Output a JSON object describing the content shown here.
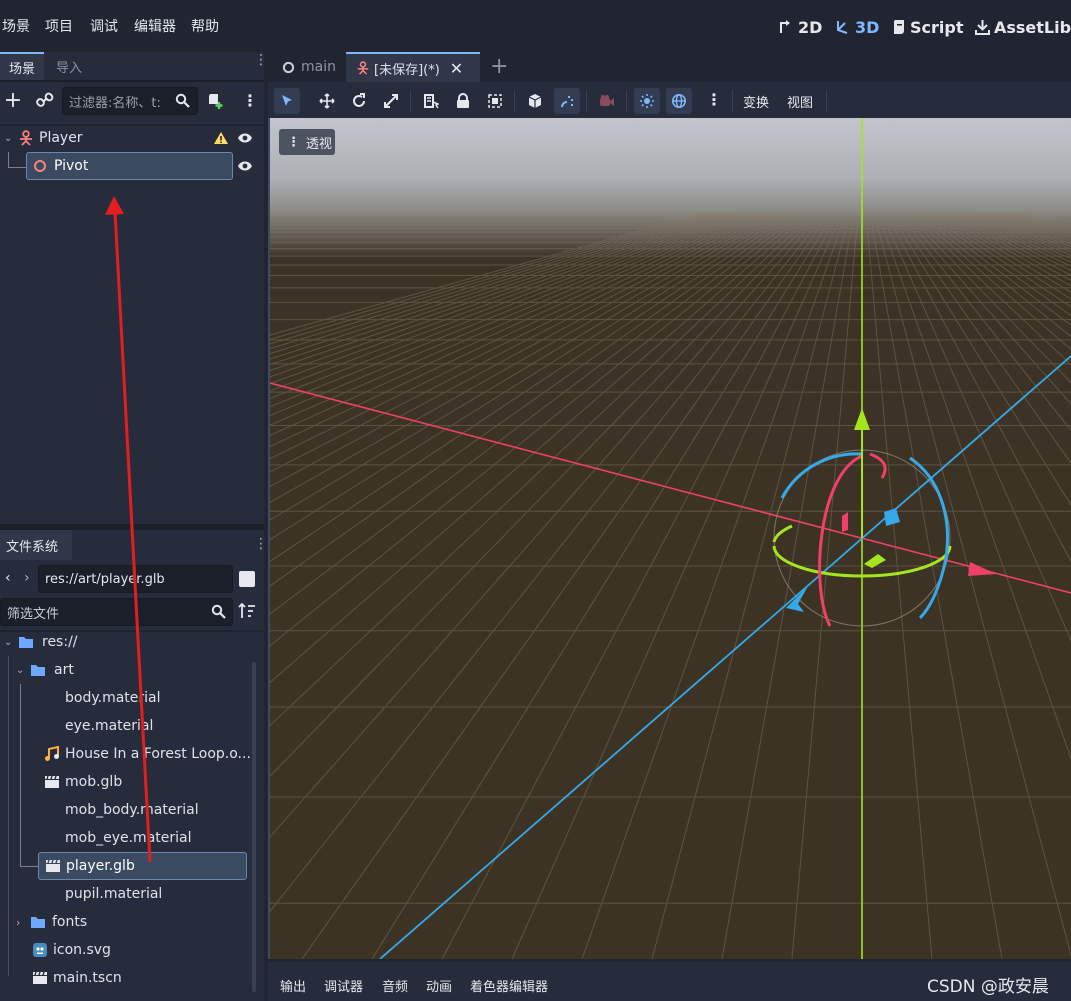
{
  "menu": [
    "场景",
    "项目",
    "调试",
    "编辑器",
    "帮助"
  ],
  "modes": [
    {
      "label": "2D",
      "icon": "2d-mode-icon",
      "active": false
    },
    {
      "label": "3D",
      "icon": "3d-mode-icon",
      "active": true
    },
    {
      "label": "Script",
      "icon": "script-icon",
      "active": false
    },
    {
      "label": "AssetLib",
      "icon": "assetlib-icon",
      "active": false
    }
  ],
  "scene_dock": {
    "tabs": [
      "场景",
      "导入"
    ],
    "filter_placeholder": "过滤器:名称、t:",
    "tree": [
      {
        "label": "Player",
        "icon": "character-node-icon",
        "warning": true
      },
      {
        "label": "Pivot",
        "icon": "node3d-icon",
        "selected": true
      }
    ]
  },
  "filesystem": {
    "tab": "文件系统",
    "path": "res://art/player.glb",
    "filter_placeholder": "筛选文件",
    "items": [
      {
        "label": "res://",
        "icon": "folder-icon",
        "level": 0
      },
      {
        "label": "art",
        "icon": "folder-icon",
        "level": 1
      },
      {
        "label": "body.material",
        "icon": "",
        "level": 2
      },
      {
        "label": "eye.material",
        "icon": "",
        "level": 2
      },
      {
        "label": "House In a Forest Loop.o...",
        "icon": "audio-icon",
        "level": 2
      },
      {
        "label": "mob.glb",
        "icon": "scene-icon",
        "level": 2
      },
      {
        "label": "mob_body.material",
        "icon": "",
        "level": 2
      },
      {
        "label": "mob_eye.material",
        "icon": "",
        "level": 2
      },
      {
        "label": "player.glb",
        "icon": "scene-icon",
        "level": 2,
        "selected": true
      },
      {
        "label": "pupil.material",
        "icon": "",
        "level": 2
      },
      {
        "label": "fonts",
        "icon": "folder-icon",
        "level": 1
      },
      {
        "label": "icon.svg",
        "icon": "image-icon",
        "level": 1
      },
      {
        "label": "main.tscn",
        "icon": "scene-icon",
        "level": 1
      }
    ]
  },
  "editor_tabs": [
    {
      "label": "main",
      "active": false
    },
    {
      "label": "[未保存](*)",
      "active": true
    }
  ],
  "toolbar": {
    "transform_label": "变换",
    "view_label": "视图"
  },
  "viewport": {
    "perspective_label": "透视"
  },
  "bottom_tabs": [
    "输出",
    "调试器",
    "音频",
    "动画",
    "着色器编辑器"
  ],
  "watermark": "CSDN @政安晨",
  "colors": {
    "accent": "#7fb8ff",
    "x_axis": "#f0406a",
    "y_axis": "#a5e51e",
    "z_axis": "#35a9ea",
    "arrow": "#e31e1e"
  }
}
